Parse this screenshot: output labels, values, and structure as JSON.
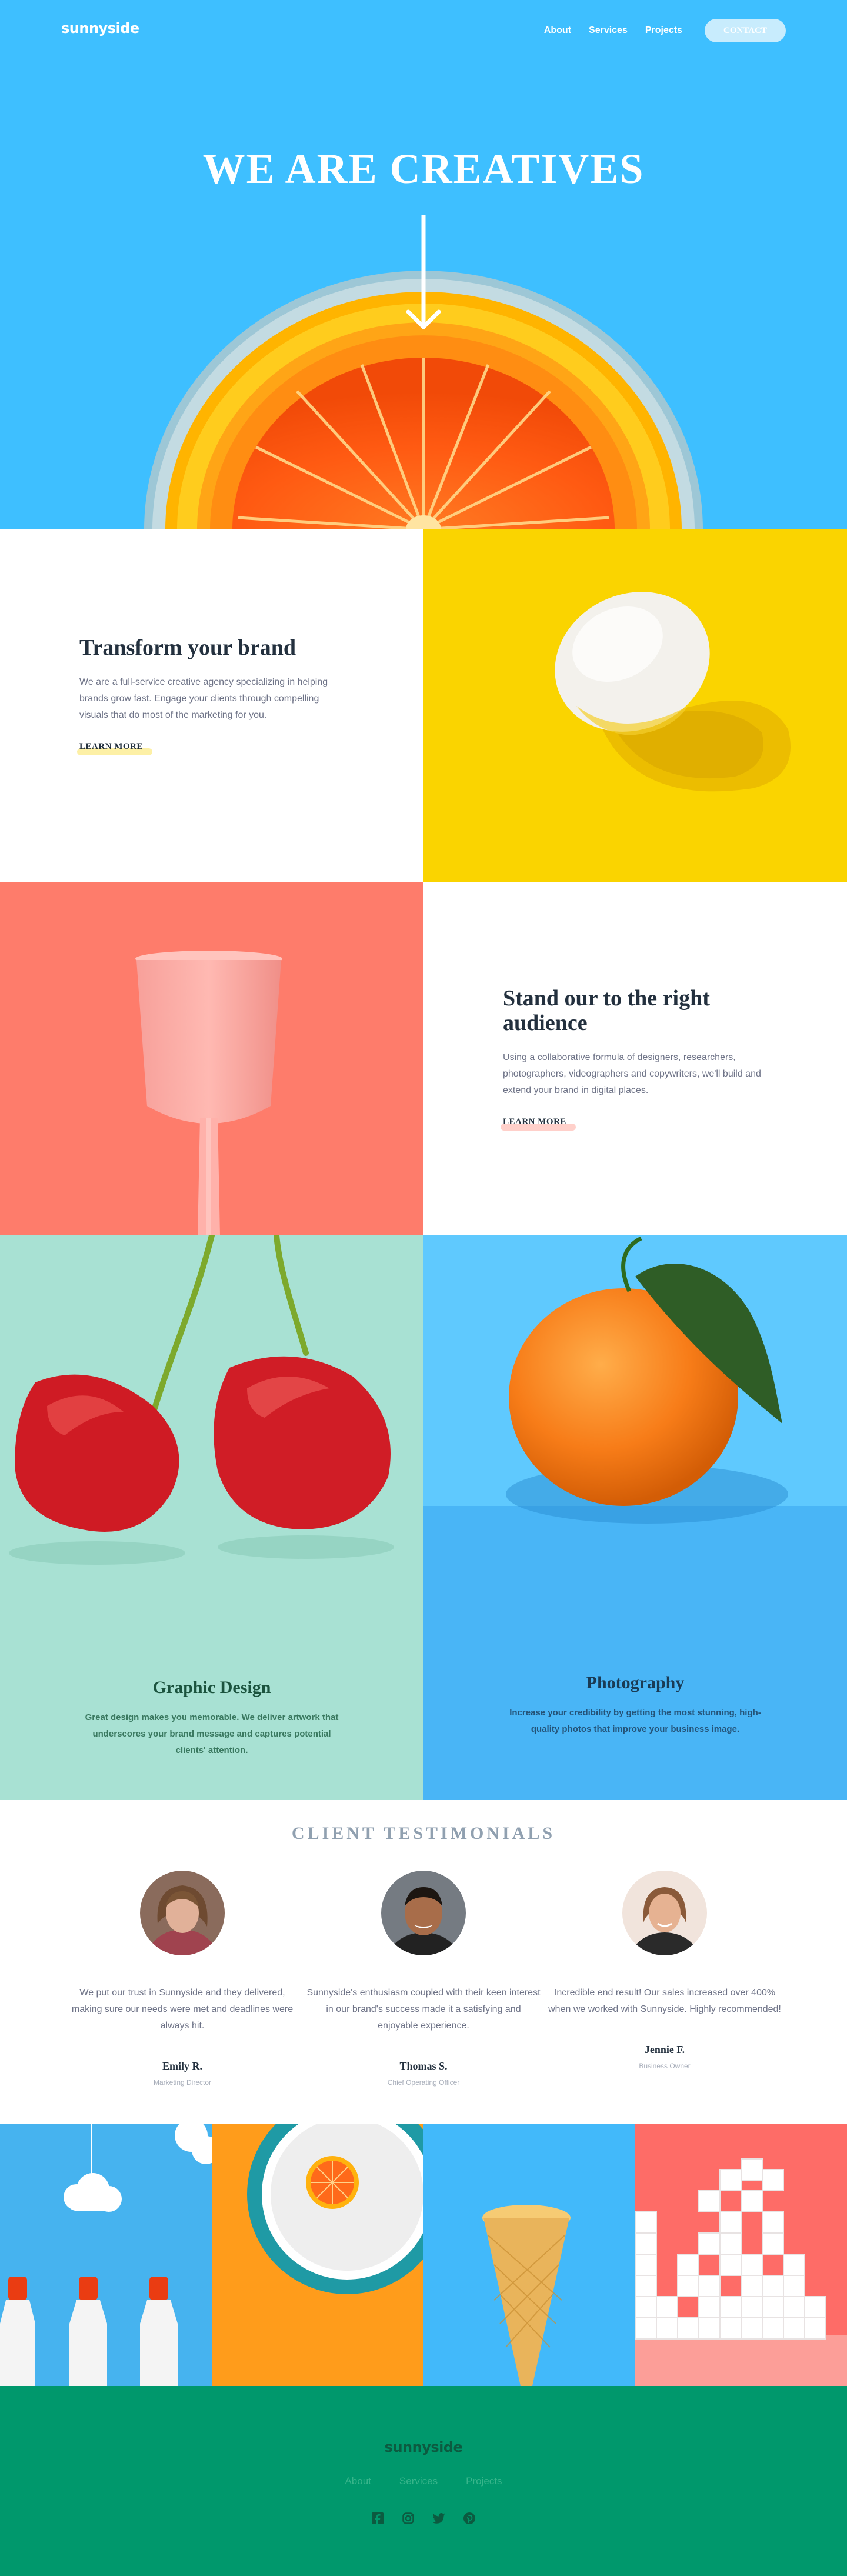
{
  "brand": {
    "logo": "sunnyside"
  },
  "nav": {
    "items": [
      {
        "label": "About"
      },
      {
        "label": "Services"
      },
      {
        "label": "Projects"
      }
    ],
    "contact_label": "Contact"
  },
  "hero": {
    "title": "WE ARE CREATIVES"
  },
  "transform": {
    "title": "Transform your brand",
    "body": "We are a full-service creative agency specializing in helping brands grow fast. Engage your clients through compelling visuals that do most of the marketing for you.",
    "link": "Learn more",
    "accent": "#fad400"
  },
  "audience": {
    "title": "Stand our to the right audience",
    "body": "Using a collaborative formula of designers, researchers, photographers, videographers and copywriters, we'll build and extend your brand in digital places.",
    "link": "Learn more",
    "accent": "#fe7766"
  },
  "services": {
    "graphic": {
      "title": "Graphic Design",
      "desc": "Great design makes you memorable. We deliver artwork that underscores your brand message and captures potential clients' attention.",
      "color": "#1b533e",
      "bg": "#a8e1d3"
    },
    "photo": {
      "title": "Photography",
      "desc": "Increase your credibility by getting the most stunning, high-quality photos that improve your business image.",
      "color": "#1a3b55",
      "bg": "#5fc9fe"
    }
  },
  "testimonials": {
    "heading": "Client testimonials",
    "items": [
      {
        "quote": "We put our trust in Sunnyside and they delivered, making sure our needs were met and deadlines were always hit.",
        "name": "Emily R.",
        "role": "Marketing Director"
      },
      {
        "quote": "Sunnyside's enthusiasm coupled with their keen interest in our brand's success made it a satisfying and enjoyable experience.",
        "name": "Thomas S.",
        "role": "Chief Operating Officer"
      },
      {
        "quote": "Incredible end result! Our sales increased over 400% when we worked with Sunnyside. Highly recommended!",
        "name": "Jennie F.",
        "role": "Business Owner"
      }
    ]
  },
  "footer": {
    "logo": "sunnyside",
    "links": [
      {
        "label": "About"
      },
      {
        "label": "Services"
      },
      {
        "label": "Projects"
      }
    ],
    "social": [
      "facebook-icon",
      "instagram-icon",
      "twitter-icon",
      "pinterest-icon"
    ]
  },
  "colors": {
    "hero_bg": "#3ebfff",
    "egg_bg": "#fad400",
    "glass_bg": "#fe7766",
    "footer_bg": "#00986c"
  }
}
